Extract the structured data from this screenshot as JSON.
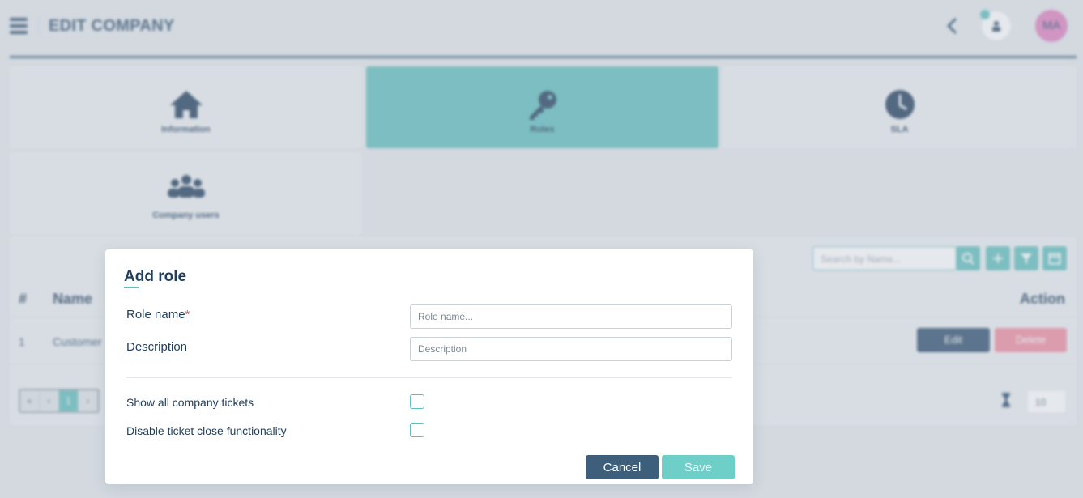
{
  "header": {
    "title": "EDIT COMPANY",
    "avatar_initials": "MA"
  },
  "tabs": [
    {
      "label": "Information",
      "icon": "home-icon",
      "active": false
    },
    {
      "label": "Roles",
      "icon": "key-icon",
      "active": true
    },
    {
      "label": "SLA",
      "icon": "clock-icon",
      "active": false
    },
    {
      "label": "Company users",
      "icon": "users-icon",
      "active": false
    }
  ],
  "table": {
    "search_placeholder": "Search by Name...",
    "columns": [
      "#",
      "Name",
      "Action"
    ],
    "rows": [
      {
        "index": "1",
        "name": "Customer"
      }
    ],
    "edit_label": "Edit",
    "delete_label": "Delete",
    "pagination": {
      "first": "«",
      "prev": "‹",
      "current": "1",
      "next": "›"
    },
    "page_size": "10"
  },
  "modal": {
    "title": "Add role",
    "role_name_label": "Role name",
    "required_mark": "*",
    "role_name_placeholder": "Role name...",
    "description_label": "Description",
    "description_placeholder": "Description",
    "show_all_label": "Show all company tickets",
    "disable_close_label": "Disable ticket close functionality",
    "cancel_label": "Cancel",
    "save_label": "Save"
  },
  "colors": {
    "accent": "#5fbfbd",
    "primary": "#2d4d6d",
    "danger": "#f08aa0"
  }
}
